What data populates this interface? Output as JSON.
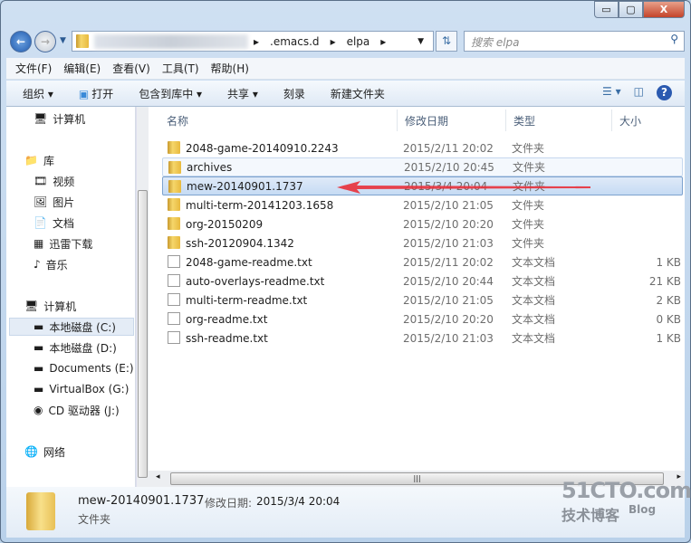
{
  "window": {
    "minimize": "▭",
    "maximize": "▢",
    "close": "X"
  },
  "address": {
    "segments": [
      ".emacs.d",
      "elpa"
    ],
    "search_placeholder": "搜索 elpa"
  },
  "menu": [
    "文件(F)",
    "编辑(E)",
    "查看(V)",
    "工具(T)",
    "帮助(H)"
  ],
  "toolbar": {
    "organize": "组织 ▾",
    "open": "打开",
    "include": "包含到库中 ▾",
    "share": "共享 ▾",
    "burn": "刻录",
    "new_folder": "新建文件夹"
  },
  "nav": {
    "items": [
      "计算机",
      "库",
      "视频",
      "图片",
      "文档",
      "迅雷下载",
      "音乐",
      "计算机",
      "本地磁盘 (C:)",
      "本地磁盘 (D:)",
      "Documents (E:)",
      "VirtualBox (G:)",
      "CD 驱动器 (J:)",
      "网络"
    ]
  },
  "columns": {
    "name": "名称",
    "date": "修改日期",
    "type": "类型",
    "size": "大小"
  },
  "files": [
    {
      "name": "2048-game-20140910.2243",
      "date": "2015/2/11 20:02",
      "type": "文件夹",
      "size": "",
      "kind": "folder"
    },
    {
      "name": "archives",
      "date": "2015/2/10 20:45",
      "type": "文件夹",
      "size": "",
      "kind": "folder"
    },
    {
      "name": "mew-20140901.1737",
      "date": "2015/3/4 20:04",
      "type": "文件夹",
      "size": "",
      "kind": "folder"
    },
    {
      "name": "multi-term-20141203.1658",
      "date": "2015/2/10 21:05",
      "type": "文件夹",
      "size": "",
      "kind": "folder"
    },
    {
      "name": "org-20150209",
      "date": "2015/2/10 20:20",
      "type": "文件夹",
      "size": "",
      "kind": "folder"
    },
    {
      "name": "ssh-20120904.1342",
      "date": "2015/2/10 21:03",
      "type": "文件夹",
      "size": "",
      "kind": "folder"
    },
    {
      "name": "2048-game-readme.txt",
      "date": "2015/2/11 20:02",
      "type": "文本文档",
      "size": "1 KB",
      "kind": "doc"
    },
    {
      "name": "auto-overlays-readme.txt",
      "date": "2015/2/10 20:44",
      "type": "文本文档",
      "size": "21 KB",
      "kind": "doc"
    },
    {
      "name": "multi-term-readme.txt",
      "date": "2015/2/10 21:05",
      "type": "文本文档",
      "size": "2 KB",
      "kind": "doc"
    },
    {
      "name": "org-readme.txt",
      "date": "2015/2/10 20:20",
      "type": "文本文档",
      "size": "0 KB",
      "kind": "doc"
    },
    {
      "name": "ssh-readme.txt",
      "date": "2015/2/10 21:03",
      "type": "文本文档",
      "size": "1 KB",
      "kind": "doc"
    }
  ],
  "details": {
    "name": "mew-20140901.1737",
    "date_label": "修改日期:",
    "date": "2015/3/4 20:04",
    "type": "文件夹"
  },
  "watermark": {
    "line1": "51CTO.com",
    "line2": "技术博客",
    "blog": "Blog"
  },
  "colors": {
    "selection": "#c6dbf4",
    "annotation_arrow": "#e8303a"
  }
}
